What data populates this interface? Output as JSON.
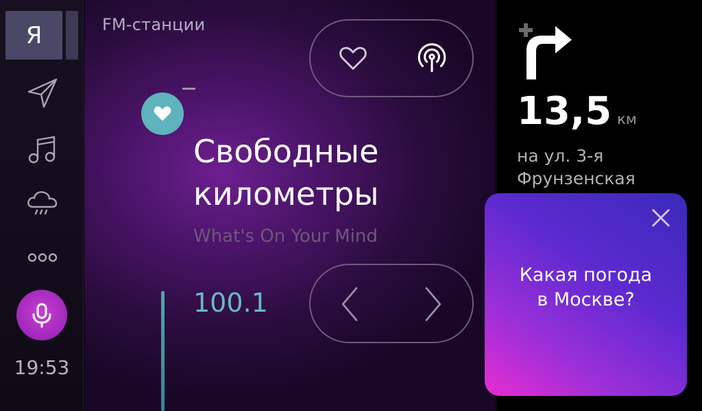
{
  "sidebar": {
    "logo_letter": "Я",
    "items": [
      {
        "icon": "navigator-arrow-icon"
      },
      {
        "icon": "music-note-icon"
      },
      {
        "icon": "weather-rain-icon"
      },
      {
        "icon": "more-dots-icon"
      }
    ],
    "mic_icon": "microphone-icon",
    "clock": "19:53"
  },
  "radio": {
    "section_label": "FM-станции",
    "station_line1": "Свободные",
    "station_line2": "километры",
    "track": "What's On Your Mind",
    "frequency": "100.1",
    "icons": {
      "favorite": "heart-outline-icon",
      "broadcast": "broadcast-icon",
      "prev": "chevron-left-icon",
      "next": "chevron-right-icon"
    }
  },
  "navigation": {
    "distance_value": "13,5",
    "distance_unit": "км",
    "street_line1": "на ул. 3-я",
    "street_line2": "Фрунзенская",
    "turn_icon": "turn-right-icon"
  },
  "assistant": {
    "query_line1": "Какая погода",
    "query_line2": "в Москве?",
    "close_icon": "close-icon"
  },
  "colors": {
    "accent_teal": "#5fb3bc",
    "mic_purple": "#a62bbf",
    "assistant_gradient_start": "#e62dd0",
    "assistant_gradient_end": "#3a2ab8"
  }
}
